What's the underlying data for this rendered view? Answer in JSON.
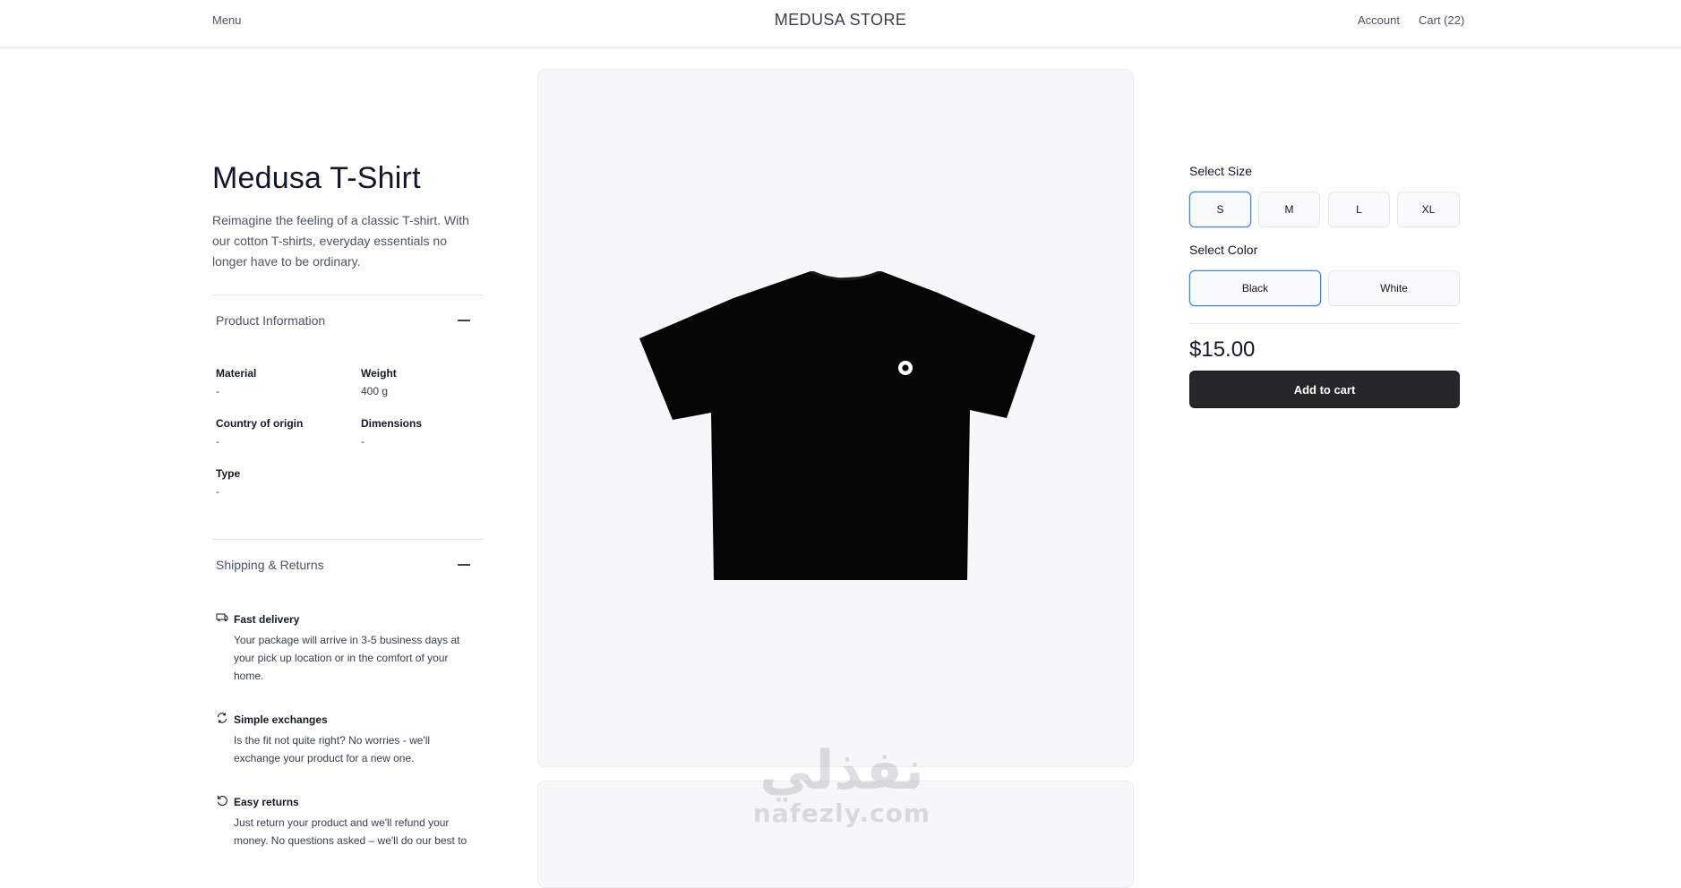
{
  "header": {
    "menu_label": "Menu",
    "brand": "MEDUSA STORE",
    "account_label": "Account",
    "cart_label": "Cart (22)"
  },
  "product": {
    "title": "Medusa T-Shirt",
    "description": "Reimagine the feeling of a classic T-shirt. With our cotton T-shirts, everyday essentials no longer have to be ordinary.",
    "image_alt": "black-tshirt"
  },
  "product_info": {
    "heading": "Product Information",
    "fields": [
      {
        "label": "Material",
        "value": "-"
      },
      {
        "label": "Weight",
        "value": "400 g"
      },
      {
        "label": "Country of origin",
        "value": "-"
      },
      {
        "label": "Dimensions",
        "value": "-"
      },
      {
        "label": "Type",
        "value": "-"
      }
    ]
  },
  "shipping": {
    "heading": "Shipping & Returns",
    "items": [
      {
        "icon": "fast-delivery-icon",
        "title": "Fast delivery",
        "text": "Your package will arrive in 3-5 business days at your pick up location or in the comfort of your home."
      },
      {
        "icon": "refresh-icon",
        "title": "Simple exchanges",
        "text": "Is the fit not quite right? No worries - we'll exchange your product for a new one."
      },
      {
        "icon": "return-icon",
        "title": "Easy returns",
        "text": "Just return your product and we'll refund your money. No questions asked – we'll do our best to"
      }
    ]
  },
  "options": {
    "size_label": "Select Size",
    "sizes": [
      "S",
      "M",
      "L",
      "XL"
    ],
    "selected_size": "S",
    "color_label": "Select Color",
    "colors": [
      "Black",
      "White"
    ],
    "selected_color": "Black"
  },
  "price": "$15.00",
  "add_to_cart_label": "Add to cart",
  "watermark": {
    "arabic": "نفذلي",
    "latin": "nafezly.com"
  },
  "colors": {
    "accent": "#3b82f6",
    "button_dark": "#27272a",
    "image_bg": "#f6f7f9"
  }
}
